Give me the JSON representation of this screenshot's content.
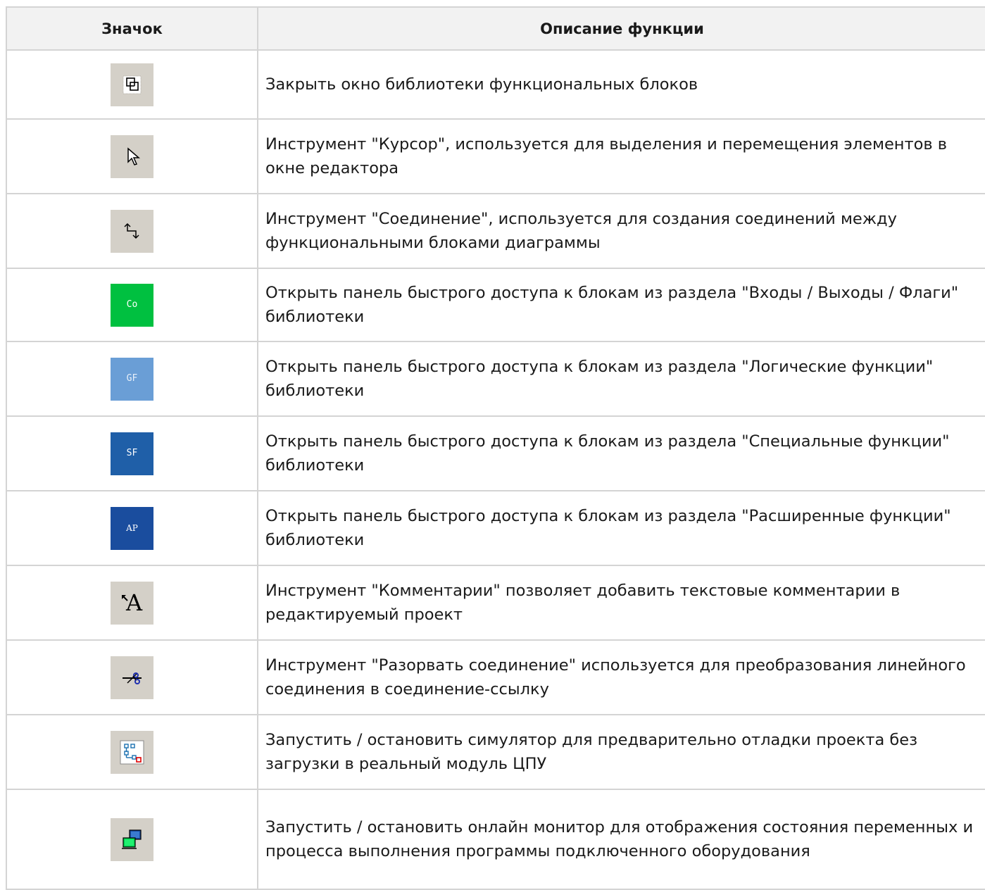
{
  "table": {
    "header": {
      "icon_col": "Значок",
      "desc_col": "Описание функции"
    },
    "rows": [
      {
        "icon": "close-library-icon",
        "description": "Закрыть окно библиотеки функциональных блоков"
      },
      {
        "icon": "cursor-icon",
        "description": "Инструмент \"Курсор\", используется для выделения и перемещения элементов в окне редактора"
      },
      {
        "icon": "connection-icon",
        "description": "Инструмент \"Соединение\", используется для создания соединений между функциональными блоками диаграммы"
      },
      {
        "icon": "co-block-icon",
        "label": "Co",
        "description": "Открыть панель быстрого доступа к блокам из раздела \"Входы / Выходы / Флаги\" библиотеки"
      },
      {
        "icon": "gf-block-icon",
        "label": "GF",
        "description": "Открыть панель быстрого доступа к блокам из раздела \"Логические функции\" библиотеки"
      },
      {
        "icon": "sf-block-icon",
        "label": "SF",
        "description": "Открыть панель быстрого доступа к блокам из раздела \"Специальные функции\" библиотеки"
      },
      {
        "icon": "ap-block-icon",
        "label": "AP",
        "description": "Открыть панель быстрого доступа к блокам из раздела \"Расширенные функции\" библиотеки"
      },
      {
        "icon": "comment-icon",
        "label": "A",
        "description": "Инструмент \"Комментарии\" позволяет добавить текстовые комментарии в редактируемый проект"
      },
      {
        "icon": "break-connection-icon",
        "description": "Инструмент \"Разорвать соединение\" используется для преобразования линейного соединения в соединение-ссылку"
      },
      {
        "icon": "simulator-icon",
        "description": "Запустить / остановить симулятор для предварительно отладки проекта без загрузки в реальный модуль ЦПУ"
      },
      {
        "icon": "online-monitor-icon",
        "description": "Запустить / остановить онлайн монитор для отображения состояния переменных и процесса выполнения программы подключенного оборудования"
      }
    ],
    "colors": {
      "co": "#00c040",
      "gf": "#6a9ed6",
      "sf": "#1f5fa8",
      "ap": "#1a4d9e"
    }
  }
}
